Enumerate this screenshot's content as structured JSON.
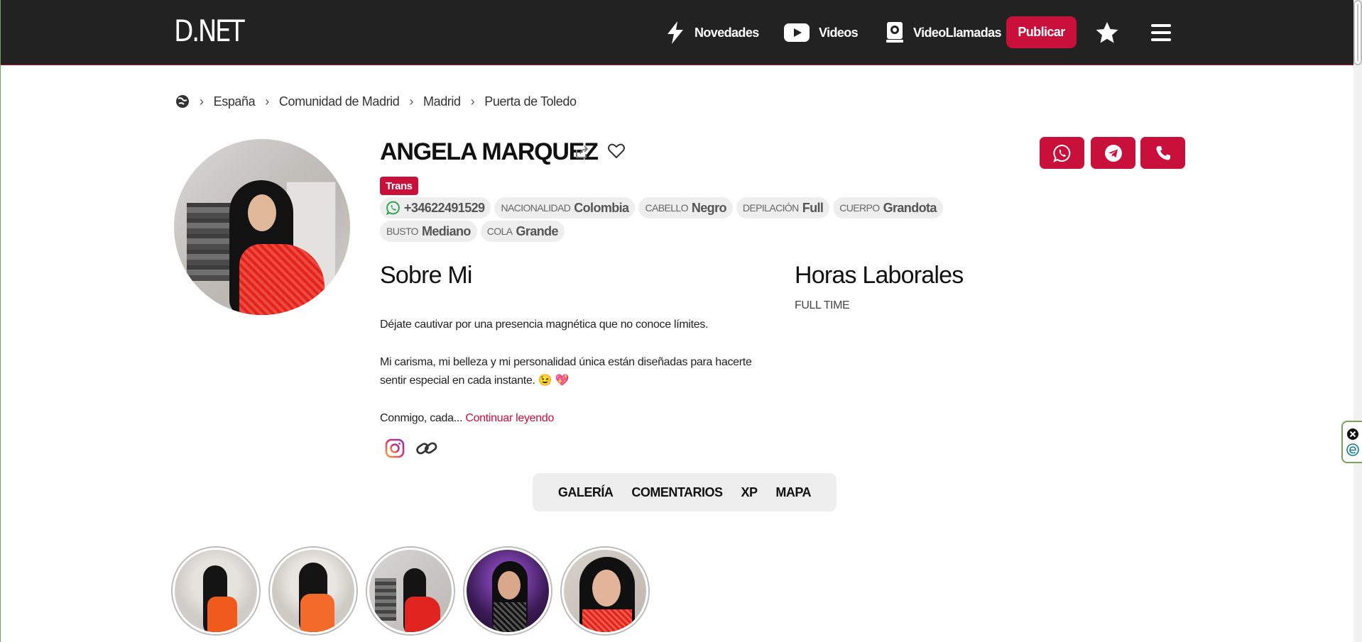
{
  "header": {
    "logo_text": "D.NET",
    "nav": [
      {
        "label": "Novedades",
        "icon": "lightning-icon"
      },
      {
        "label": "Videos",
        "icon": "play-icon"
      },
      {
        "label": "VideoLlamadas",
        "icon": "webcam-icon"
      }
    ],
    "publish_label": "Publicar",
    "accent_color": "#c8103a",
    "bar_color": "#222222"
  },
  "breadcrumb": [
    "España",
    "Comunidad de Madrid",
    "Madrid",
    "Puerta de Toledo"
  ],
  "profile": {
    "name": "ANGELA MARQUEZ",
    "badge": "Trans",
    "phone": "+34622491529",
    "attributes": [
      {
        "key": "Nacionalidad",
        "value": "Colombia"
      },
      {
        "key": "Cabello",
        "value": "Negro"
      },
      {
        "key": "Depilación",
        "value": "Full"
      },
      {
        "key": "Cuerpo",
        "value": "Grandota"
      },
      {
        "key": "Busto",
        "value": "Mediano"
      },
      {
        "key": "Cola",
        "value": "Grande"
      }
    ]
  },
  "about": {
    "title": "Sobre Mi",
    "p1": "Déjate cautivar por una presencia magnética que no conoce límites.",
    "p2": "Mi carisma, mi belleza y mi personalidad única están diseñadas para hacerte sentir especial en cada instante. 😉 💖",
    "p3": "Conmigo, cada...",
    "read_more": "Continuar leyendo"
  },
  "hours": {
    "title": "Horas Laborales",
    "value": "FULL TIME"
  },
  "tabs": [
    "GALERÍA",
    "COMENTARIOS",
    "XP",
    "MAPA"
  ],
  "gallery_count": 5
}
